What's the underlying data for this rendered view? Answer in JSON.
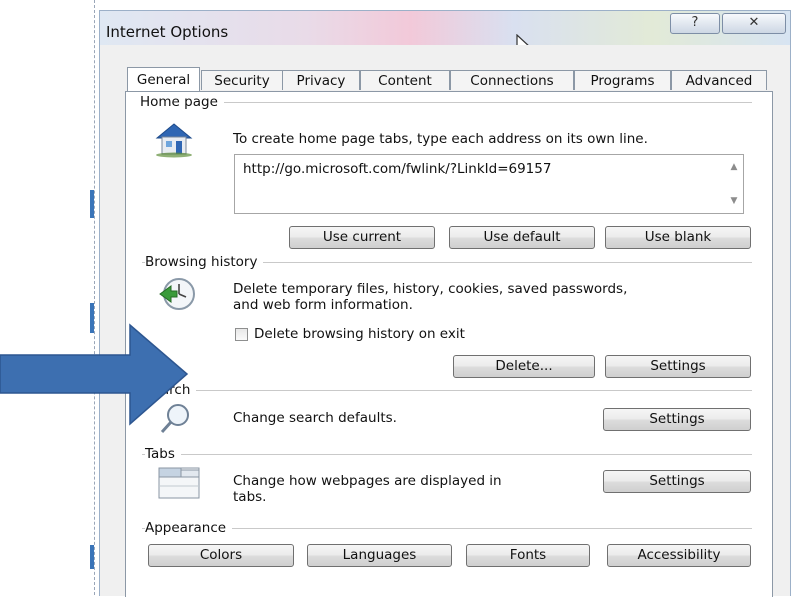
{
  "window": {
    "title": "Internet Options",
    "help_button": "?",
    "close_button": "✕"
  },
  "tabs": [
    {
      "label": "General",
      "active": true
    },
    {
      "label": "Security",
      "active": false
    },
    {
      "label": "Privacy",
      "active": false
    },
    {
      "label": "Content",
      "active": false
    },
    {
      "label": "Connections",
      "active": false
    },
    {
      "label": "Programs",
      "active": false
    },
    {
      "label": "Advanced",
      "active": false
    }
  ],
  "home_page": {
    "group_label": "Home page",
    "instructions": "To create home page tabs, type each address on its own line.",
    "address_value": "http://go.microsoft.com/fwlink/?LinkId=69157",
    "use_current": "Use current",
    "use_default": "Use default",
    "use_blank": "Use blank"
  },
  "browsing_history": {
    "group_label": "Browsing history",
    "description_line1": "Delete temporary files, history, cookies, saved passwords,",
    "description_line2": "and web form information.",
    "delete_on_exit_label": "Delete browsing history on exit",
    "delete_on_exit_checked": false,
    "delete_button": "Delete...",
    "settings_button": "Settings"
  },
  "search": {
    "group_label": "Search",
    "description": "Change search defaults.",
    "settings_button": "Settings"
  },
  "tabs_section": {
    "group_label": "Tabs",
    "description_line1": "Change how webpages are displayed in",
    "description_line2": "tabs.",
    "settings_button": "Settings"
  },
  "appearance": {
    "group_label": "Appearance",
    "colors_button": "Colors",
    "languages_button": "Languages",
    "fonts_button": "Fonts",
    "accessibility_button": "Accessibility"
  },
  "colors": {
    "arrow": "#3d6fb0",
    "panel_bg": "#ffffff",
    "dialog_bg": "#f0f0f0"
  }
}
